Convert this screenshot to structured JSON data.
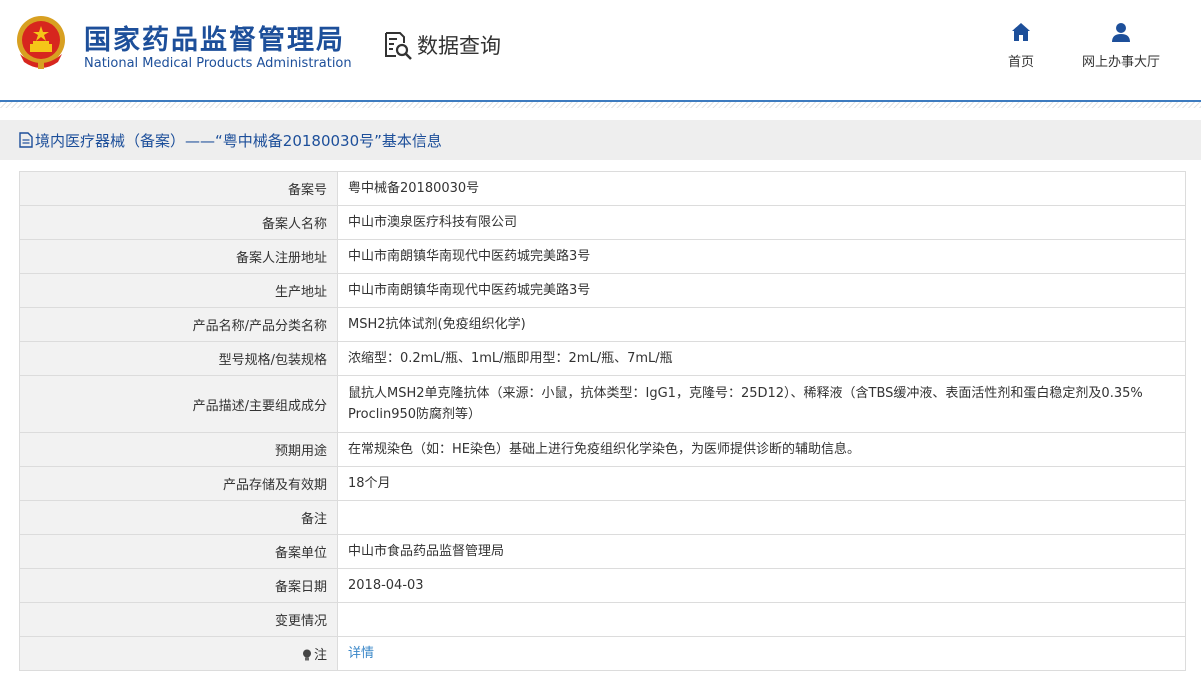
{
  "header": {
    "title_cn": "国家药品监督管理局",
    "title_en": "National Medical Products Administration",
    "query_label": "数据查询",
    "nav": {
      "home": "首页",
      "hall": "网上办事大厅"
    }
  },
  "section": {
    "title": "境内医疗器械（备案）——“粤中械备20180030号”基本信息"
  },
  "rows": [
    {
      "label": "备案号",
      "value": "粤中械备20180030号"
    },
    {
      "label": "备案人名称",
      "value": "中山市澳泉医疗科技有限公司"
    },
    {
      "label": "备案人注册地址",
      "value": "中山市南朗镇华南现代中医药城完美路3号"
    },
    {
      "label": "生产地址",
      "value": "中山市南朗镇华南现代中医药城完美路3号"
    },
    {
      "label": "产品名称/产品分类名称",
      "value": "MSH2抗体试剂(免疫组织化学)"
    },
    {
      "label": "型号规格/包装规格",
      "value": "浓缩型：0.2mL/瓶、1mL/瓶即用型：2mL/瓶、7mL/瓶"
    },
    {
      "label": "产品描述/主要组成成分",
      "value": "鼠抗人MSH2单克隆抗体（来源：小鼠，抗体类型：IgG1，克隆号：25D12）、稀释液（含TBS缓冲液、表面活性剂和蛋白稳定剂及0.35% Proclin950防腐剂等）"
    },
    {
      "label": "预期用途",
      "value": "在常规染色（如：HE染色）基础上进行免疫组织化学染色，为医师提供诊断的辅助信息。"
    },
    {
      "label": "产品存储及有效期",
      "value": "18个月"
    },
    {
      "label": "备注",
      "value": ""
    },
    {
      "label": "备案单位",
      "value": "中山市食品药品监督管理局"
    },
    {
      "label": "备案日期",
      "value": "2018-04-03"
    },
    {
      "label": "变更情况",
      "value": ""
    },
    {
      "label": "注",
      "value": "详情"
    }
  ],
  "colors": {
    "brand": "#1d4f9a",
    "link": "#3a87c8",
    "label_bg": "#f2f2f2"
  },
  "icons": {
    "home": "home-icon",
    "hall": "user-icon",
    "query": "search-document-icon",
    "note": "bulb-icon"
  }
}
